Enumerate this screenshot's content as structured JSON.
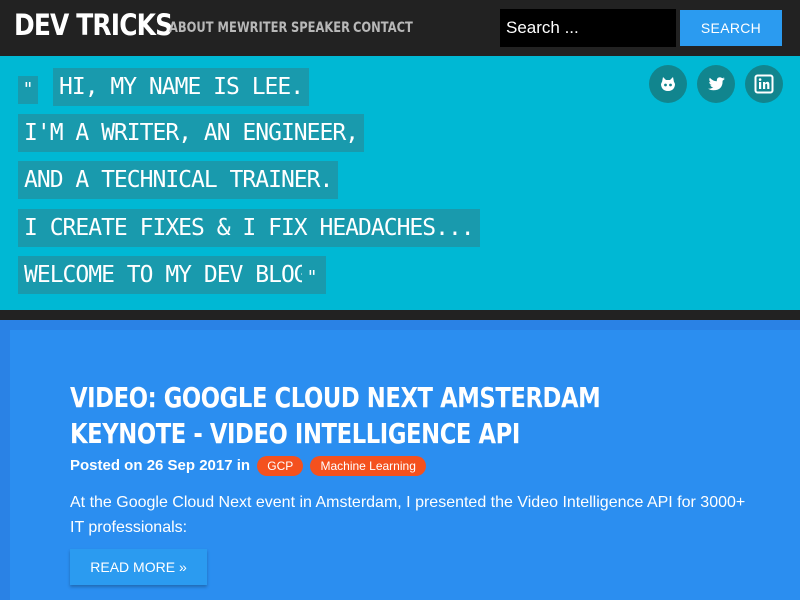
{
  "site": {
    "brand": "DEV TRICKS",
    "nav": [
      "ABOUT ME",
      "WRITER",
      "SPEAKER",
      "CONTACT"
    ],
    "search": {
      "placeholder": "Search ...",
      "button_label": "SEARCH"
    }
  },
  "hero": {
    "open_quote": "\"",
    "close_quote": "\"",
    "lines": [
      "HI, MY NAME IS LEE.",
      "I'M A WRITER, AN ENGINEER,",
      "AND A TECHNICAL TRAINER.",
      "I CREATE FIXES & I FIX HEADACHES...",
      "WELCOME TO MY DEV BLOG."
    ],
    "social_icons": [
      "github-icon",
      "twitter-icon",
      "linkedin-icon"
    ]
  },
  "post": {
    "title": "VIDEO: GOOGLE CLOUD NEXT AMSTERDAM KEYNOTE - VIDEO INTELLIGENCE API",
    "posted_prefix": "Posted on",
    "date": "26 Sep 2017",
    "in_word": "in",
    "tags": [
      "GCP",
      "Machine Learning"
    ],
    "excerpt": "At the Google Cloud Next event in Amsterdam, I presented the Video Intelligence API for 3000+ IT professionals:",
    "read_more": "READ MORE »"
  },
  "colors": {
    "nav_bg": "#222222",
    "hero_bg": "#00b8d4",
    "hero_highlight": "#199aad",
    "content_bg": "#2b8ef0",
    "button_blue": "#2b9bf0",
    "tag_orange": "#f4511e"
  }
}
